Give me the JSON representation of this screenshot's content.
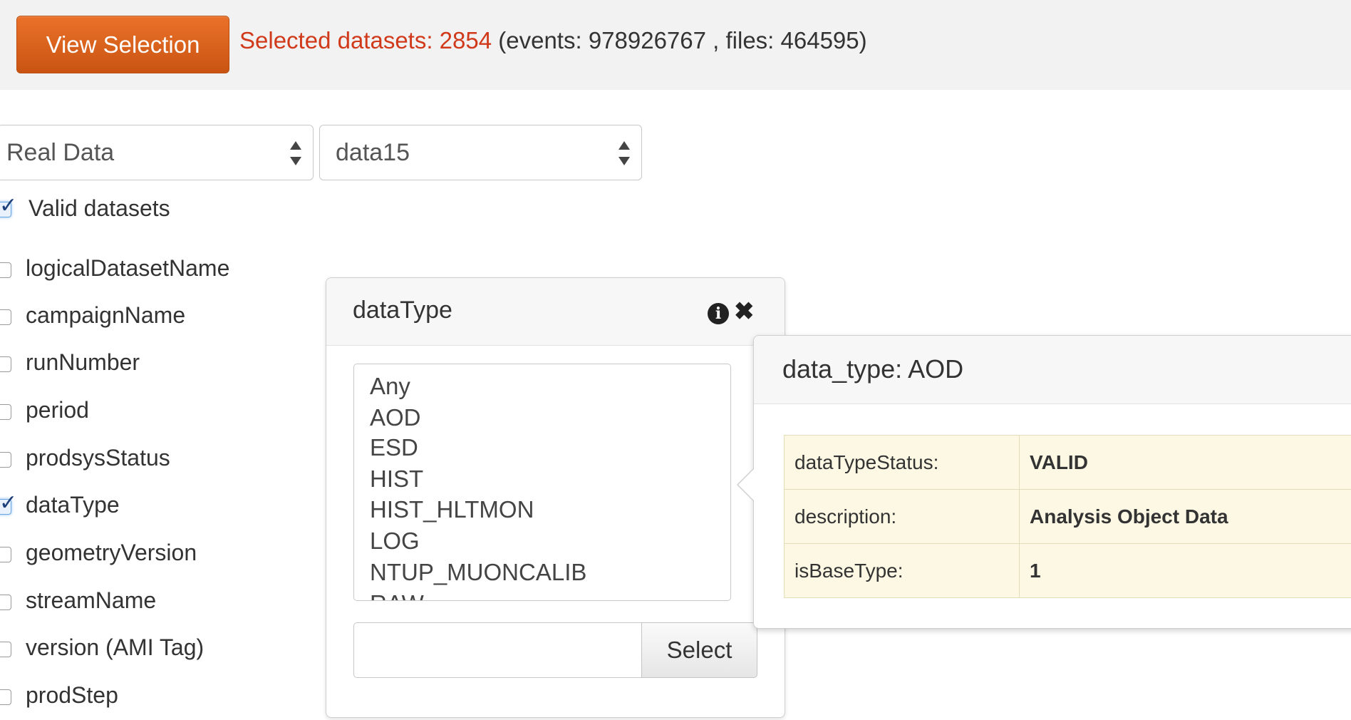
{
  "toolbar": {
    "view_selection_label": "View Selection",
    "selected_prefix": "Selected datasets: 2854",
    "selected_suffix": " (events: 978926767 , files: 464595)"
  },
  "filters": {
    "data_source": "Real Data",
    "project": "data15"
  },
  "valid_datasets": {
    "label": "Valid datasets",
    "checked": true
  },
  "fields": [
    {
      "label": "logicalDatasetName",
      "checked": false
    },
    {
      "label": "campaignName",
      "checked": false
    },
    {
      "label": "runNumber",
      "checked": false
    },
    {
      "label": "period",
      "checked": false
    },
    {
      "label": "prodsysStatus",
      "checked": false
    },
    {
      "label": "dataType",
      "checked": true
    },
    {
      "label": "geometryVersion",
      "checked": false
    },
    {
      "label": "streamName",
      "checked": false
    },
    {
      "label": "version (AMI Tag)",
      "checked": false
    },
    {
      "label": "prodStep",
      "checked": false
    }
  ],
  "popover": {
    "title": "dataType",
    "options": [
      "Any",
      "AOD",
      "ESD",
      "HIST",
      "HIST_HLTMON",
      "LOG",
      "NTUP_MUONCALIB",
      "RAW"
    ],
    "filter_value": "",
    "select_label": "Select"
  },
  "tooltip": {
    "title": "data_type: AOD",
    "rows": [
      {
        "key": "dataTypeStatus:",
        "value": "VALID"
      },
      {
        "key": "description:",
        "value": "Analysis Object Data"
      },
      {
        "key": "isBaseType:",
        "value": "1"
      }
    ]
  },
  "colors": {
    "primary_button": "#d85f1c",
    "selected_text": "#d0391a",
    "tooltip_table_bg": "#fcf8e3"
  }
}
